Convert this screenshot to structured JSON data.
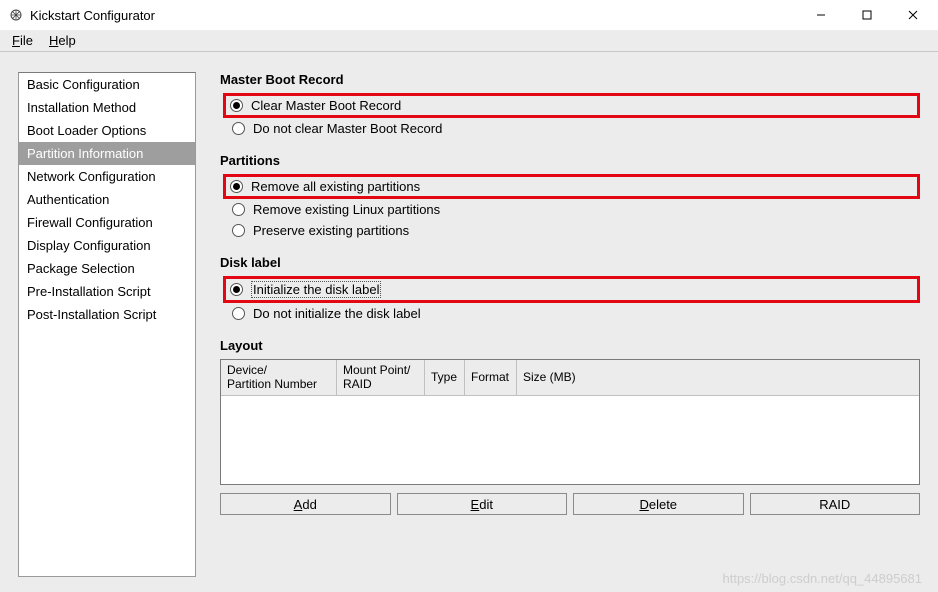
{
  "window": {
    "title": "Kickstart Configurator"
  },
  "menu": {
    "file": "File",
    "help": "Help"
  },
  "sidebar": {
    "items": [
      "Basic Configuration",
      "Installation Method",
      "Boot Loader Options",
      "Partition Information",
      "Network Configuration",
      "Authentication",
      "Firewall Configuration",
      "Display Configuration",
      "Package Selection",
      "Pre-Installation Script",
      "Post-Installation Script"
    ],
    "selected_index": 3
  },
  "sections": {
    "mbr": {
      "label": "Master Boot Record",
      "options": [
        "Clear Master Boot Record",
        "Do not clear Master Boot Record"
      ],
      "selected": 0
    },
    "partitions": {
      "label": "Partitions",
      "options": [
        "Remove all existing partitions",
        "Remove existing Linux partitions",
        "Preserve existing partitions"
      ],
      "selected": 0
    },
    "disklabel": {
      "label": "Disk label",
      "options": [
        "Initialize the disk label",
        "Do not initialize the disk label"
      ],
      "selected": 0
    },
    "layout": {
      "label": "Layout",
      "columns": [
        "Device/\nPartition Number",
        "Mount Point/\nRAID",
        "Type",
        "Format",
        "Size (MB)"
      ],
      "rows": []
    }
  },
  "buttons": {
    "add": "Add",
    "edit": "Edit",
    "delete": "Delete",
    "raid": "RAID"
  },
  "watermark": "https://blog.csdn.net/qq_44895681"
}
